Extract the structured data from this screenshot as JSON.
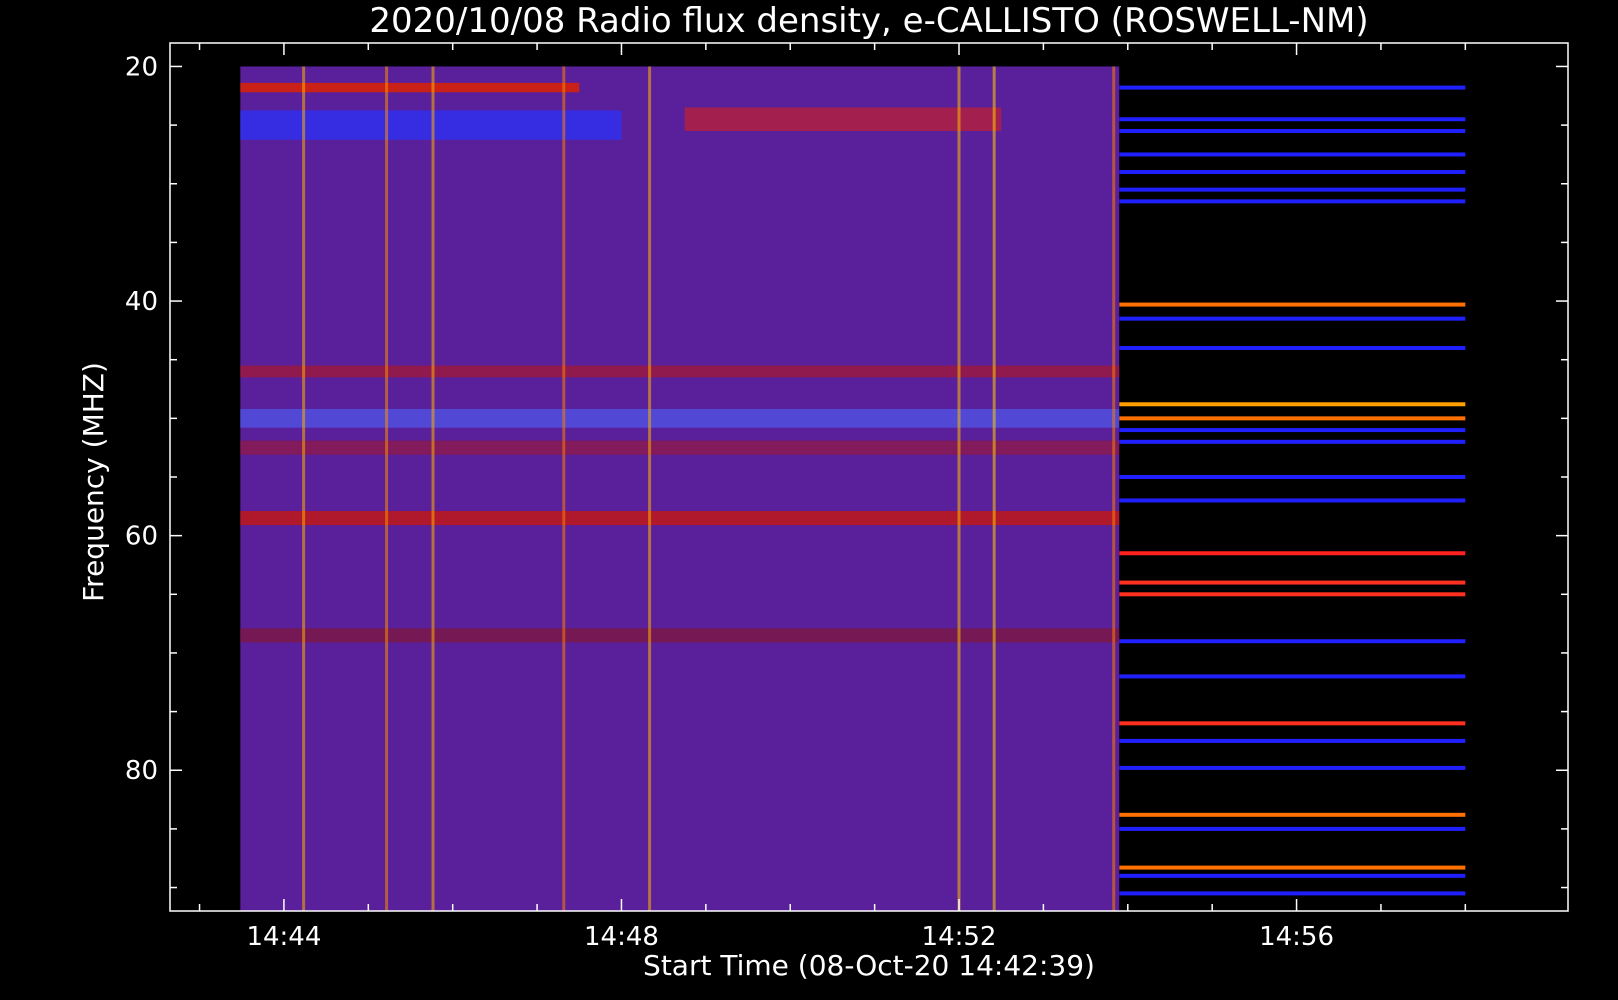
{
  "chart_data": {
    "type": "heatmap",
    "title": "2020/10/08  Radio flux density, e-CALLISTO (ROSWELL-NM)",
    "xlabel": "Start Time (08-Oct-20 14:42:39)",
    "ylabel": "Frequency (MHZ)",
    "x_unit": "UT time",
    "xlim": [
      "14:42:39",
      "14:59:13"
    ],
    "ylim": [
      92,
      18
    ],
    "x_tick_labels": [
      "14:44",
      "14:48",
      "14:52",
      "14:56"
    ],
    "y_tick_labels": [
      "20",
      "40",
      "60",
      "80"
    ],
    "data_time_range": [
      "14:43:29",
      "14:58:00"
    ],
    "data_freq_range": [
      20,
      92
    ],
    "colormap": "blue-red-yellow",
    "panels": [
      {
        "name": "spectrogram",
        "time_range": [
          "14:43:29",
          "14:53:54"
        ],
        "background": "#5a1f9a",
        "horizontal_bands": [
          {
            "freq": 21.8,
            "width": 0.8,
            "color": "#dd2200",
            "time_range": [
              "14:43:29",
              "14:47:30"
            ]
          },
          {
            "freq": 25,
            "width": 2.5,
            "color": "#3030f0",
            "time_range": [
              "14:43:29",
              "14:48:00"
            ]
          },
          {
            "freq": 24.5,
            "width": 2,
            "color": "#b02040",
            "time_range": [
              "14:48:45",
              "14:52:30"
            ]
          },
          {
            "freq": 46,
            "width": 1,
            "color": "#9a1a40",
            "time_range": [
              "14:43:29",
              "14:53:54"
            ]
          },
          {
            "freq": 50,
            "width": 1.6,
            "color": "#5050e0",
            "time_range": [
              "14:43:29",
              "14:53:54"
            ]
          },
          {
            "freq": 52.5,
            "width": 1.2,
            "color": "#8a1a50",
            "time_range": [
              "14:43:29",
              "14:53:54"
            ]
          },
          {
            "freq": 58.5,
            "width": 1.2,
            "color": "#c01818",
            "time_range": [
              "14:43:29",
              "14:53:54"
            ]
          },
          {
            "freq": 68.5,
            "width": 1.2,
            "color": "#7a1848",
            "time_range": [
              "14:43:29",
              "14:53:54"
            ]
          }
        ],
        "vertical_bursts": [
          {
            "time": "14:44:14",
            "freq_range": [
              20,
              92
            ],
            "color": "#ffb000"
          },
          {
            "time": "14:45:13",
            "freq_range": [
              20,
              92
            ],
            "color": "#ff9000"
          },
          {
            "time": "14:45:46",
            "freq_range": [
              20,
              92
            ],
            "color": "#ffb000"
          },
          {
            "time": "14:47:19",
            "freq_range": [
              20,
              92
            ],
            "color": "#ff8000"
          },
          {
            "time": "14:48:20",
            "freq_range": [
              20,
              92
            ],
            "color": "#ffb000"
          },
          {
            "time": "14:52:00",
            "freq_range": [
              20,
              92
            ],
            "color": "#ffc000"
          },
          {
            "time": "14:52:25",
            "freq_range": [
              20,
              92
            ],
            "color": "#ffd000"
          },
          {
            "time": "14:53:50",
            "freq_range": [
              20,
              92
            ],
            "color": "#ff8000"
          }
        ]
      },
      {
        "name": "line-spectra",
        "time_range": [
          "14:53:54",
          "14:58:00"
        ],
        "background": "#000000",
        "lines": [
          {
            "freq": 21.8,
            "color": "#2020ff"
          },
          {
            "freq": 24.5,
            "color": "#2020ff"
          },
          {
            "freq": 25.5,
            "color": "#2020ff"
          },
          {
            "freq": 27.5,
            "color": "#2020ff"
          },
          {
            "freq": 29,
            "color": "#2020ff"
          },
          {
            "freq": 30.5,
            "color": "#2020ff"
          },
          {
            "freq": 31.5,
            "color": "#2020ff"
          },
          {
            "freq": 40.3,
            "color": "#ff7000"
          },
          {
            "freq": 41.5,
            "color": "#2020ff"
          },
          {
            "freq": 44,
            "color": "#2020ff"
          },
          {
            "freq": 48.8,
            "color": "#ffa000"
          },
          {
            "freq": 50,
            "color": "#ff7000"
          },
          {
            "freq": 51,
            "color": "#2020ff"
          },
          {
            "freq": 52,
            "color": "#2020ff"
          },
          {
            "freq": 55,
            "color": "#2020ff"
          },
          {
            "freq": 57,
            "color": "#2020ff"
          },
          {
            "freq": 61.5,
            "color": "#ff2020"
          },
          {
            "freq": 64,
            "color": "#ff3020"
          },
          {
            "freq": 65,
            "color": "#ff3020"
          },
          {
            "freq": 69,
            "color": "#2020ff"
          },
          {
            "freq": 72,
            "color": "#2020ff"
          },
          {
            "freq": 76,
            "color": "#ff3020"
          },
          {
            "freq": 77.5,
            "color": "#2020ff"
          },
          {
            "freq": 79.8,
            "color": "#2020ff"
          },
          {
            "freq": 83.8,
            "color": "#ff7000"
          },
          {
            "freq": 85,
            "color": "#2020ff"
          },
          {
            "freq": 88.3,
            "color": "#ff7000"
          },
          {
            "freq": 89,
            "color": "#2020ff"
          },
          {
            "freq": 90.5,
            "color": "#2020ff"
          }
        ]
      }
    ],
    "grid": false,
    "legend": "none"
  }
}
